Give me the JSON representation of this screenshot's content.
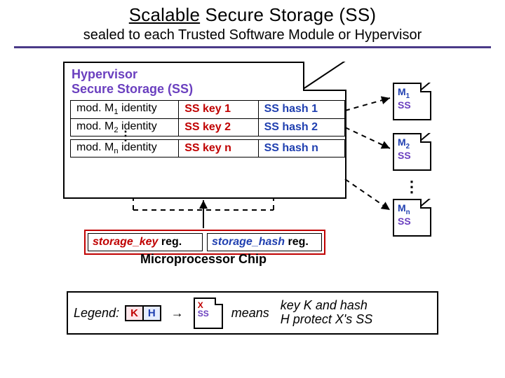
{
  "title_underlined": "Scalable",
  "title_rest": " Secure Storage (SS)",
  "subtitle": "sealed to each Trusted Software Module or Hypervisor",
  "hvss": {
    "heading_l1": "Hypervisor",
    "heading_l2": "Secure Storage (SS)",
    "rows": [
      {
        "id_prefix": "mod. M",
        "id_sub": "1",
        "id_suffix": " identity",
        "key": "SS key 1",
        "hash": "SS hash 1"
      },
      {
        "id_prefix": "mod. M",
        "id_sub": "2",
        "id_suffix": " identity",
        "key": "SS key 2",
        "hash": "SS hash 2"
      },
      {
        "id_prefix": "mod. M",
        "id_sub": "n",
        "id_suffix": " identity",
        "key": "SS key n",
        "hash": "SS hash n"
      }
    ]
  },
  "ss_docs": [
    {
      "line1_pre": "M",
      "line1_sub": "1",
      "line2": "SS"
    },
    {
      "line1_pre": "M",
      "line1_sub": "2",
      "line2": "SS"
    },
    {
      "line1_pre": "M",
      "line1_sub": "n",
      "line2": "SS"
    }
  ],
  "chip": {
    "key_reg_label": "storage_key",
    "hash_reg_label": "storage_hash",
    "reg_suffix": " reg.",
    "caption": "Microprocessor Chip"
  },
  "legend": {
    "title": "Legend:",
    "k": "K",
    "h": "H",
    "x_l1": "X",
    "x_l2": "SS",
    "means": "means",
    "desc_l1": "key K and hash",
    "desc_l2": "H protect X's SS"
  }
}
